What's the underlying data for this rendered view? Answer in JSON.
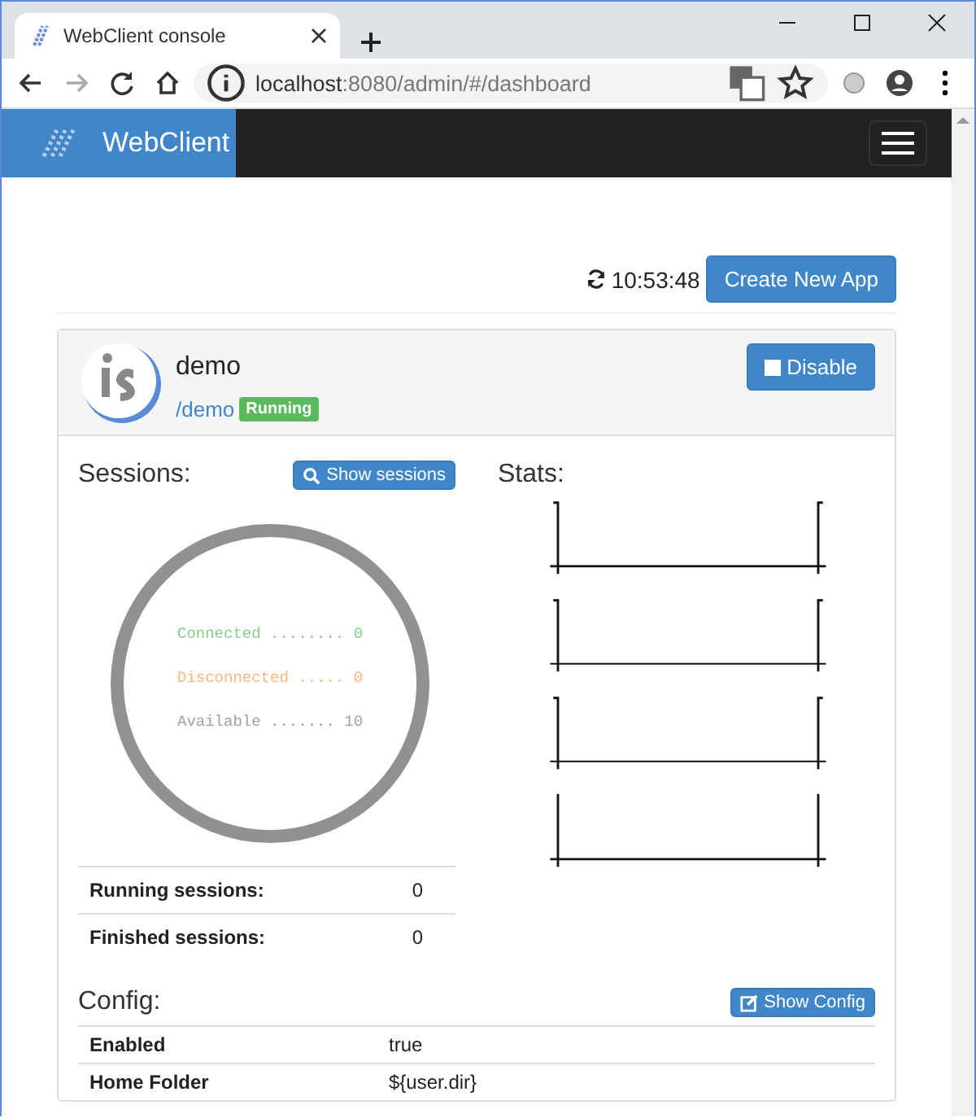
{
  "browser": {
    "tab_title": "WebClient console",
    "url_host": "localhost",
    "url_rest": ":8080/admin/#/dashboard"
  },
  "navbar": {
    "brand": "WebClient"
  },
  "toolbar": {
    "time": "10:53:48",
    "create_button": "Create New App"
  },
  "app": {
    "name": "demo",
    "path": "/demo",
    "status": "Running",
    "disable_button": "Disable",
    "sessions": {
      "title": "Sessions:",
      "button": "Show sessions",
      "legend": [
        {
          "label": "Connected ........ 0",
          "color": "#7fcf8a"
        },
        {
          "label": "Disconnected ..... 0",
          "color": "#f5b77c"
        },
        {
          "label": "Available ....... 10",
          "color": "#a0a0a0"
        }
      ],
      "rows": [
        {
          "label": "Running sessions:",
          "value": "0"
        },
        {
          "label": "Finished sessions:",
          "value": "0"
        }
      ]
    },
    "stats": {
      "title": "Stats:"
    },
    "config": {
      "title": "Config:",
      "button": "Show Config",
      "rows": [
        {
          "label": "Enabled",
          "value": "true"
        },
        {
          "label": "Home Folder",
          "value": "${user.dir}"
        }
      ]
    }
  }
}
